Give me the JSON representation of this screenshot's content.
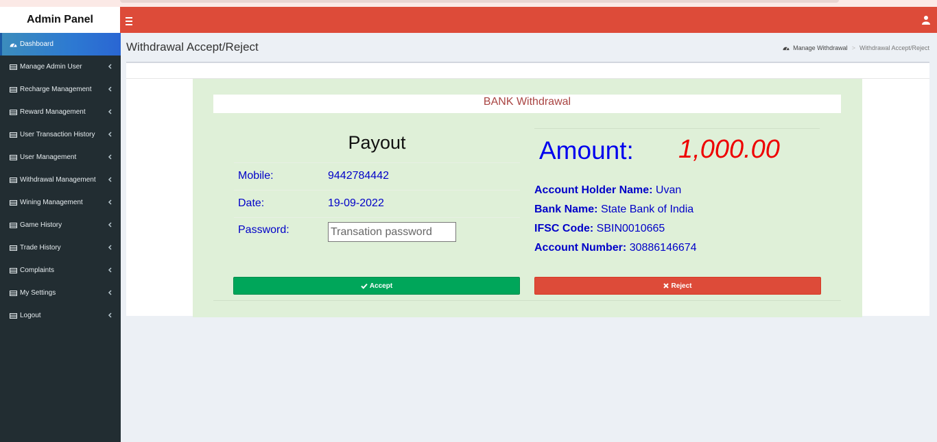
{
  "app": {
    "title": "Admin Panel"
  },
  "colors": {
    "navbar": "#dd4b39",
    "sidebar": "#222d32",
    "active": "#3c8dbc",
    "accept": "#00a65a",
    "reject": "#dd4b39",
    "panel": "#dff0d8"
  },
  "sidebar": {
    "items": [
      {
        "label": "Dashboard",
        "icon": "dashboard-icon"
      },
      {
        "label": "Manage Admin User",
        "icon": "table-icon"
      },
      {
        "label": "Recharge Management",
        "icon": "table-icon"
      },
      {
        "label": "Reward Management",
        "icon": "table-icon"
      },
      {
        "label": "User Transaction History",
        "icon": "table-icon"
      },
      {
        "label": "User Management",
        "icon": "table-icon"
      },
      {
        "label": "Withdrawal Management",
        "icon": "table-icon"
      },
      {
        "label": "Wining Management",
        "icon": "table-icon"
      },
      {
        "label": "Game History",
        "icon": "table-icon"
      },
      {
        "label": "Trade History",
        "icon": "table-icon"
      },
      {
        "label": "Complaints",
        "icon": "table-icon"
      },
      {
        "label": "My Settings",
        "icon": "table-icon"
      },
      {
        "label": "Logout",
        "icon": "table-icon"
      }
    ]
  },
  "page": {
    "title": "Withdrawal Accept/Reject",
    "breadcrumb": {
      "home": "Manage Withdrawal",
      "current": "Withdrawal Accept/Reject"
    }
  },
  "panel": {
    "heading": "BANK Withdrawal",
    "payout_title": "Payout",
    "mobile_label": "Mobile:",
    "mobile_value": "9442784442",
    "date_label": "Date:",
    "date_value": "19-09-2022",
    "password_label": "Password:",
    "password_placeholder": "Transation password",
    "amount_label": "Amount:",
    "amount_value": "1,000.00",
    "holder_label": "Account Holder Name:",
    "holder_value": "Uvan",
    "bank_label": "Bank Name:",
    "bank_value": "State Bank of India",
    "ifsc_label": "IFSC Code:",
    "ifsc_value": "SBIN0010665",
    "account_label": "Account Number:",
    "account_value": "30886146674",
    "accept_label": "Accept",
    "reject_label": "Reject"
  }
}
